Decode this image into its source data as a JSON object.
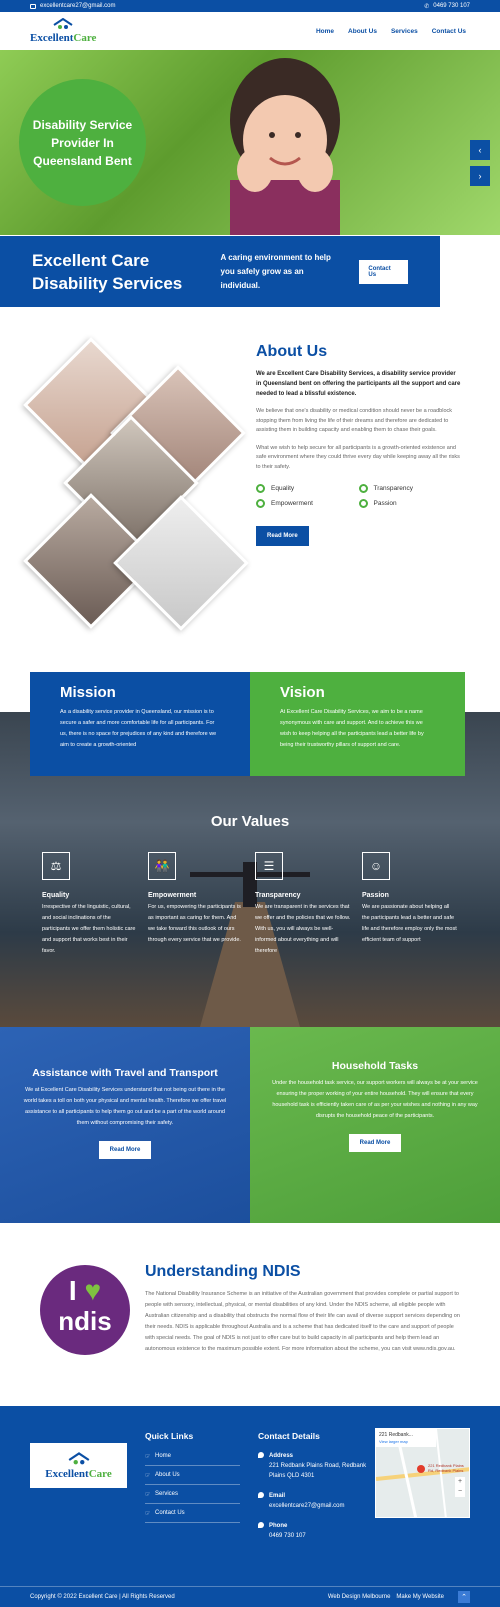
{
  "topbar": {
    "email": "excellentcare27@gmail.com",
    "phone": "0469 730 107"
  },
  "brand": {
    "name_part1": "Excellent",
    "name_part2": "Care"
  },
  "nav": {
    "items": [
      "Home",
      "About Us",
      "Services",
      "Contact Us"
    ]
  },
  "hero": {
    "circle_text": "Disability Service Provider In Queensland Bent",
    "band_title": "Excellent Care Disability Services",
    "band_text": "A caring environment to help you safely grow as an individual.",
    "band_button": "Contact Us",
    "prev_icon": "chevron-left-icon",
    "next_icon": "chevron-right-icon"
  },
  "about": {
    "title": "About Us",
    "lead": "We are Excellent Care Disability Services, a disability service provider in Queensland bent on offering the participants all the support and care needed to lead a blissful existence.",
    "p1": "We believe that one's disability or medical condition should never be a roadblock stopping them from living the life of their dreams and therefore are dedicated to assisting them in building capacity and enabling them to chase their goals.",
    "p2": "What we wish to help secure for all participants is a growth-oriented existence and safe environment where they could thrive every day while keeping away all the risks to their safety.",
    "values": [
      "Equality",
      "Transparency",
      "Empowerment",
      "Passion"
    ],
    "button": "Read More"
  },
  "mission": {
    "title": "Mission",
    "text": "As a disability service provider in Queensland, our mission is to secure a safer and more comfortable life for all participants. For us, there is no space for prejudices of any kind and therefore we aim to create a growth-oriented"
  },
  "vision": {
    "title": "Vision",
    "text": "At Excellent Care Disability Services, we aim to be a name synonymous with care and support. And to achieve this we wish to keep helping all the participants lead a better life by being their trustworthy pillars of support and care."
  },
  "our_values": {
    "title": "Our Values",
    "items": [
      {
        "icon": "scales-icon",
        "title": "Equality",
        "text": "Irrespective of the linguistic, cultural, and social inclinations of the participants we offer them holistic care and support that works best in their favor."
      },
      {
        "icon": "people-icon",
        "title": "Empowerment",
        "text": "For us, empowering the participants is as important as caring for them. And we take forward this outlook of ours through every service that we provide."
      },
      {
        "icon": "document-icon",
        "title": "Transparency",
        "text": "We are transparent in the services that we offer and the policies that we follow. With us, you will always be well-informed about everything and will therefore"
      },
      {
        "icon": "person-icon",
        "title": "Passion",
        "text": "We are passionate about helping all the participants lead a better and safe life and therefore employ only the most efficient team of support"
      }
    ]
  },
  "services": [
    {
      "title": "Assistance with Travel and Transport",
      "text": "We at Excellent Care Disability Services understand that not being out there in the world takes a toll on both your physical and mental health. Therefore we offer travel assistance to all participants to help them go out and be a part of the world around them without compromising their safety.",
      "button": "Read More"
    },
    {
      "title": "Household Tasks",
      "text": "Under the household task service, our support workers will always be at your service ensuring the proper working of your entire household. They will ensure that every household task is efficiently taken care of as per your wishes and nothing in any way disrupts the household peace of the participants.",
      "button": "Read More"
    }
  ],
  "ndis": {
    "logo_i": "I",
    "logo_word": "ndis",
    "title": "Understanding NDIS",
    "text": "The National Disability Insurance Scheme is an initiative of the Australian government that provides complete or partial support to people with sensory, intellectual, physical, or mental disabilities of any kind. Under the NDIS scheme, all eligible people with Australian citizenship and a disability that obstructs the normal flow of their life can avail of diverse support services depending on their needs. NDIS is applicable throughout Australia and is a scheme that has dedicated itself to the care and support of people with special needs. The goal of NDIS is not just to offer care but to build capacity in all participants and help them lead an autonomous existence to the maximum possible extent. For more information about the scheme, you can visit www.ndis.gov.au."
  },
  "footer": {
    "quick_links_title": "Quick Links",
    "quick_links": [
      "Home",
      "About Us",
      "Services",
      "Contact Us"
    ],
    "contact_title": "Contact Details",
    "address_label": "Address",
    "address": "221 Redbank Plains Road, Redbank Plains QLD 4301",
    "email_label": "Email",
    "email": "excellentcare27@gmail.com",
    "phone_label": "Phone",
    "phone": "0469 730 107",
    "map_label": "221 Redbank...",
    "map_link": "View larger map",
    "map_pin_label": "221 Redbank Plains Rd, Redbank Plains",
    "copyright": "Copyright © 2022 Excellent Care | All Rights Reserved",
    "credit": "Web Design Melbourne",
    "credit2": "Make My Website"
  }
}
